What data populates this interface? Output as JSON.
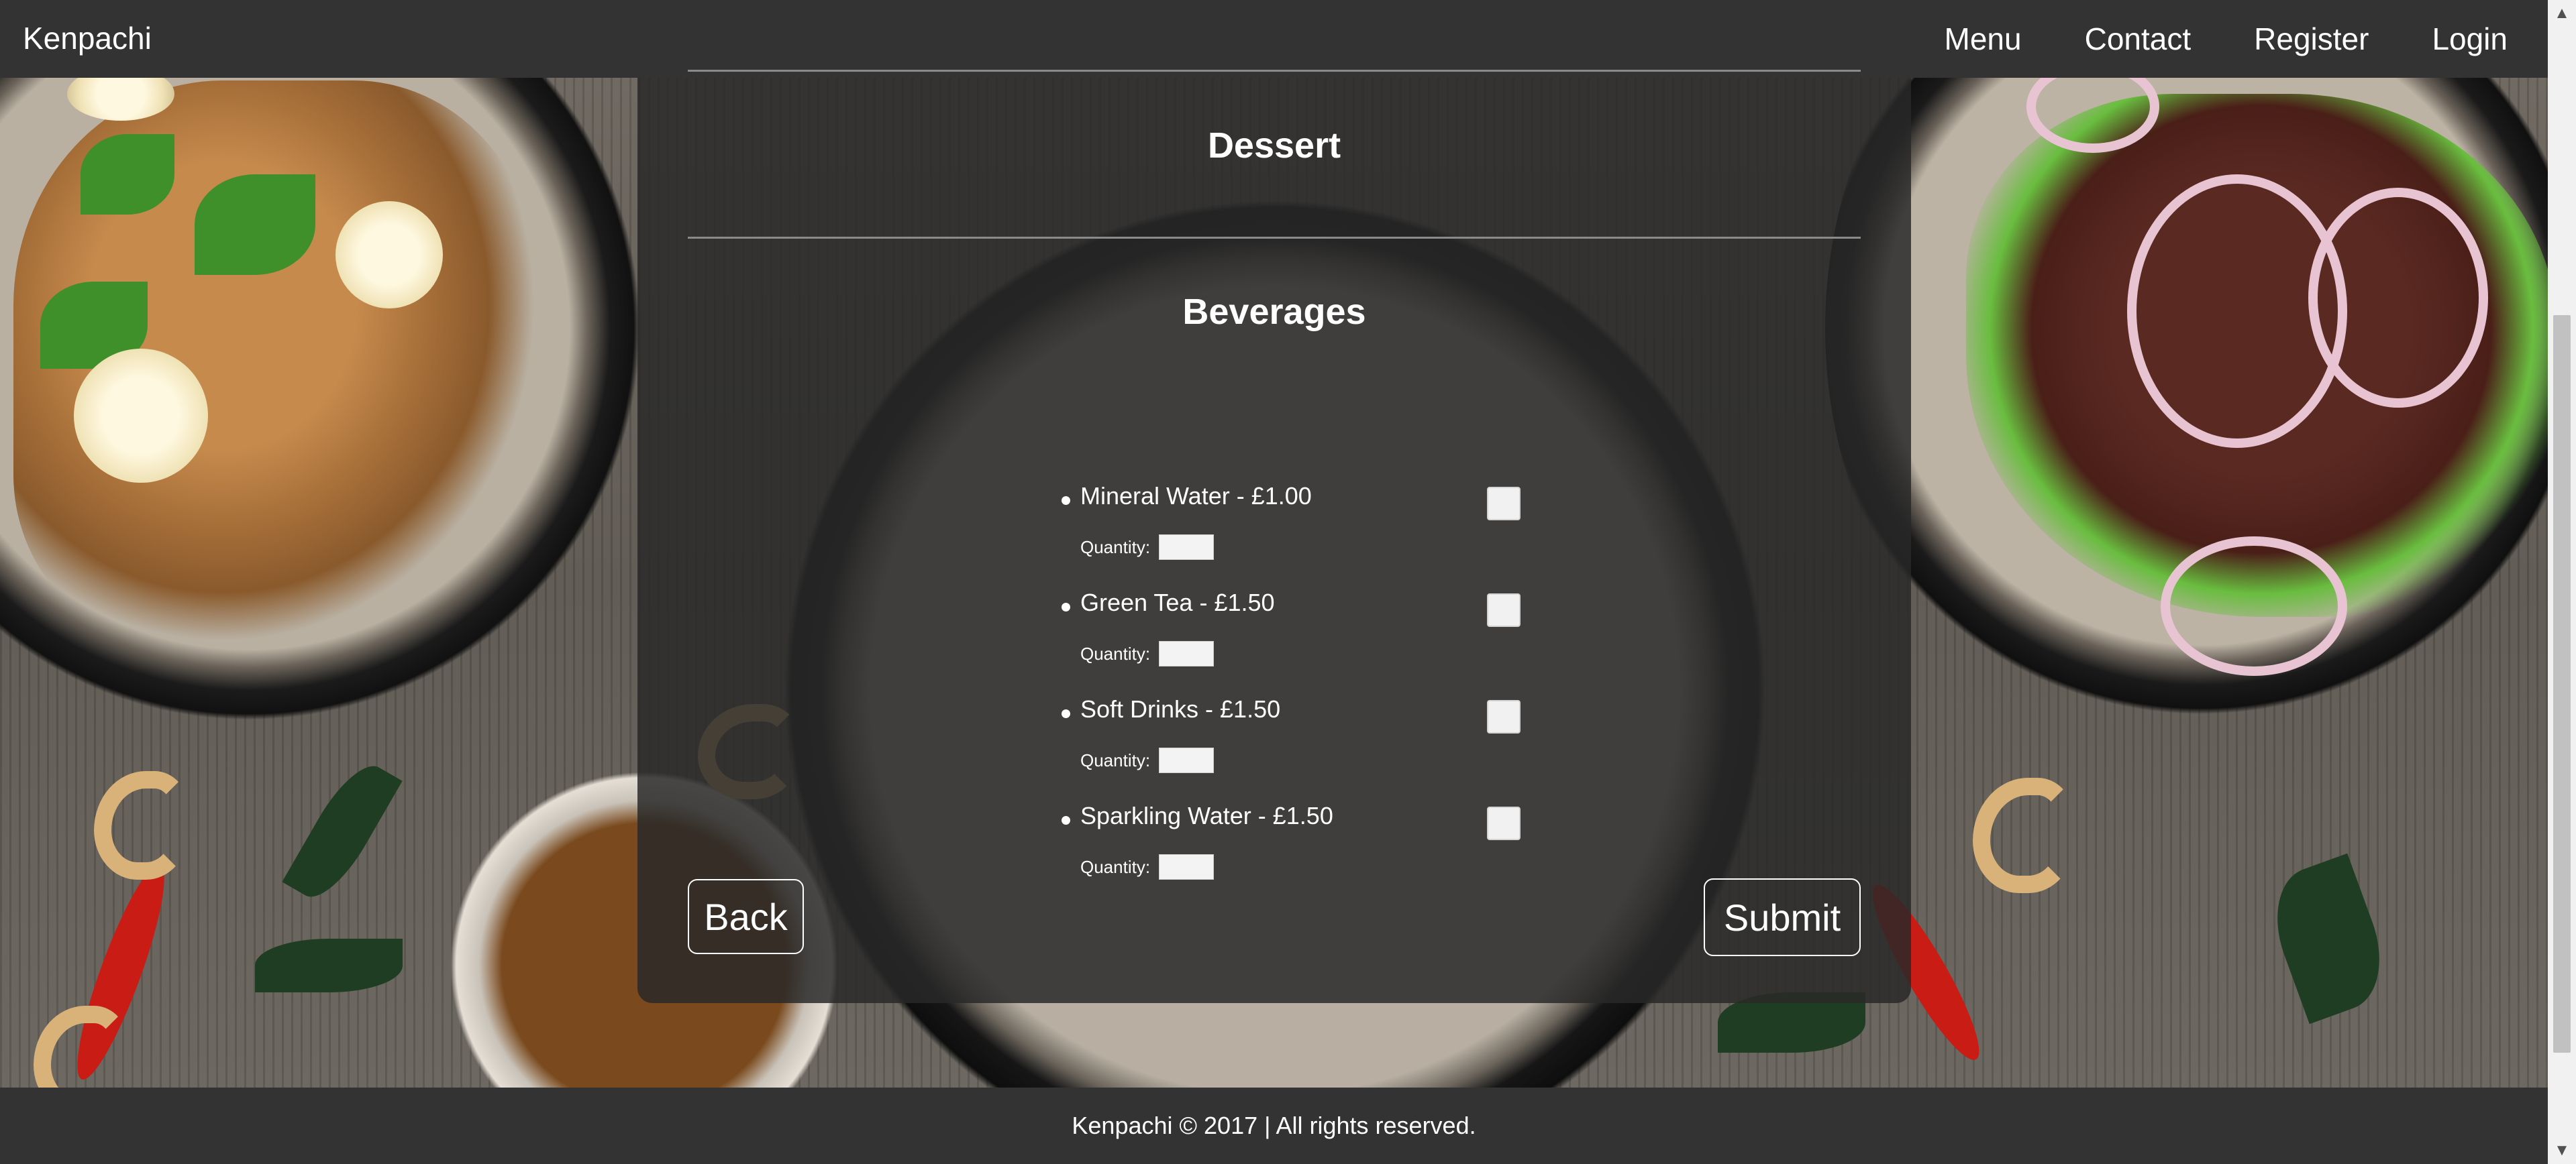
{
  "navbar": {
    "brand": "Kenpachi",
    "links": [
      "Menu",
      "Contact",
      "Register",
      "Login"
    ]
  },
  "sections": {
    "dessert_title": "Dessert",
    "beverages_title": "Beverages"
  },
  "beverages": [
    {
      "label": "Mineral Water - £1.00",
      "quantity_label": "Quantity:",
      "quantity": "",
      "checked": false
    },
    {
      "label": "Green Tea - £1.50",
      "quantity_label": "Quantity:",
      "quantity": "",
      "checked": false
    },
    {
      "label": "Soft Drinks - £1.50",
      "quantity_label": "Quantity:",
      "quantity": "",
      "checked": false
    },
    {
      "label": "Sparkling Water - £1.50",
      "quantity_label": "Quantity:",
      "quantity": "",
      "checked": false
    }
  ],
  "actions": {
    "back_label": "Back",
    "submit_label": "Submit"
  },
  "footer": {
    "text": "Kenpachi © 2017 | All rights reserved."
  },
  "colors": {
    "navbar_bg": "#333333",
    "panel_bg": "rgba(40,40,40,0.84)",
    "text": "#ffffff"
  },
  "icons": {
    "scroll_up": "scroll-up-arrow-icon",
    "scroll_down": "scroll-down-arrow-icon"
  }
}
